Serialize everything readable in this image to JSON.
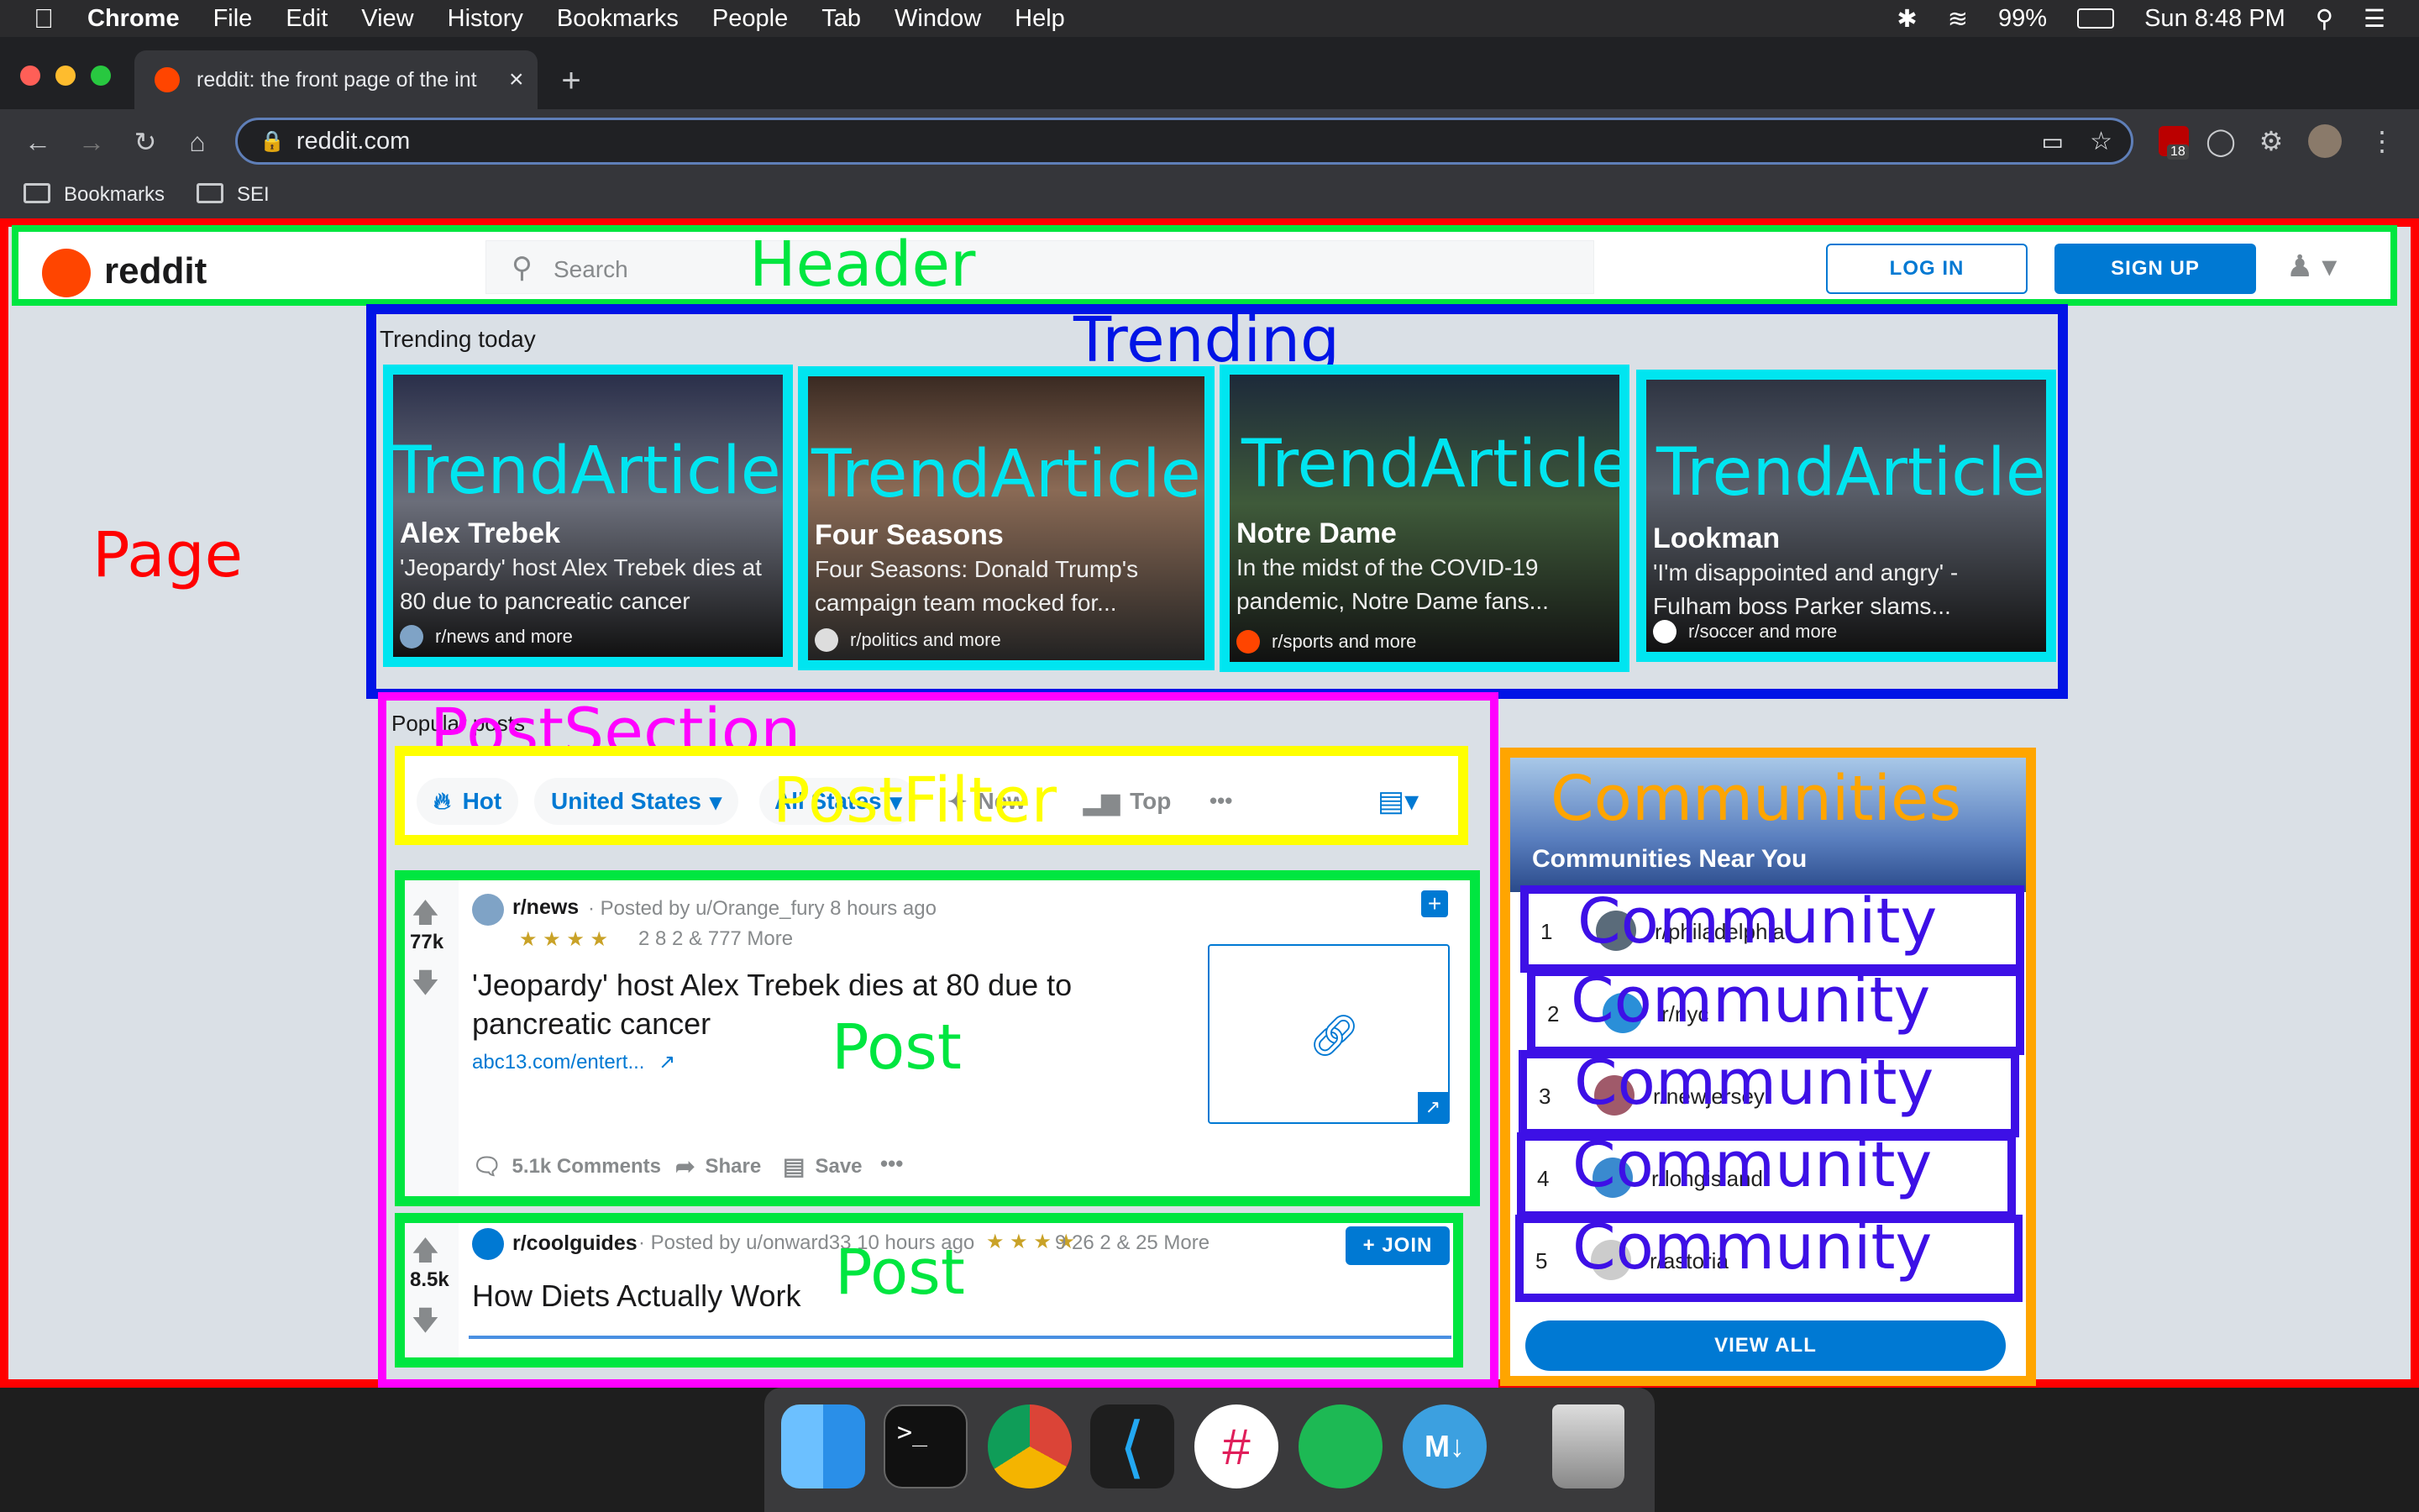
{
  "menubar": {
    "app": "Chrome",
    "items": [
      "File",
      "Edit",
      "View",
      "History",
      "Bookmarks",
      "People",
      "Tab",
      "Window",
      "Help"
    ],
    "battery": "99%",
    "clock": "Sun 8:48 PM"
  },
  "browser": {
    "tab_title": "reddit: the front page of the int",
    "url": "reddit.com",
    "bookmarks": [
      "Bookmarks",
      "SEI"
    ],
    "ext_badge": "18"
  },
  "header": {
    "logo": "reddit",
    "search_placeholder": "Search",
    "login": "LOG IN",
    "signup": "SIGN UP"
  },
  "trending": {
    "heading": "Trending today",
    "cards": [
      {
        "title": "Alex Trebek",
        "desc": "'Jeopardy' host Alex Trebek dies at 80 due to pancreatic cancer",
        "source": "r/news and more"
      },
      {
        "title": "Four Seasons",
        "desc": "Four Seasons: Donald Trump's campaign team mocked for...",
        "source": "r/politics and more"
      },
      {
        "title": "Notre Dame",
        "desc": "In the midst of the COVID-19 pandemic, Notre Dame fans...",
        "source": "r/sports and more"
      },
      {
        "title": "Lookman",
        "desc": "'I'm disappointed and angry' - Fulham boss Parker slams...",
        "source": "r/soccer and more"
      }
    ]
  },
  "popular": {
    "heading": "Popular posts",
    "filters": [
      "Hot",
      "United States",
      "All States",
      "New",
      "Top",
      "•••"
    ],
    "posts": [
      {
        "subreddit": "r/news",
        "meta": "· Posted by u/Orange_fury 8 hours ago",
        "awards": "2   8   2 & 777 More",
        "votes": "77k",
        "title": "'Jeopardy' host Alex Trebek dies at 80 due to pancreatic cancer",
        "link": "abc13.com/entert...",
        "comments": "5.1k Comments",
        "share": "Share",
        "save": "Save"
      },
      {
        "subreddit": "r/coolguides",
        "meta": "· Posted by u/onward33 10 hours ago",
        "awards": "9   26   2 & 25 More",
        "votes": "8.5k",
        "title": "How Diets Actually Work",
        "join": "+ JOIN"
      }
    ]
  },
  "communities": {
    "heading": "Communities Near You",
    "items": [
      {
        "rank": "1",
        "name": "r/philadelphia"
      },
      {
        "rank": "2",
        "name": "r/nyc"
      },
      {
        "rank": "3",
        "name": "r/newjersey"
      },
      {
        "rank": "4",
        "name": "r/longisland"
      },
      {
        "rank": "5",
        "name": "r/astoria"
      }
    ],
    "view_all": "VIEW ALL"
  },
  "annotations": {
    "page": "Page",
    "header": "Header",
    "trending": "Trending",
    "trend_article": "TrendArticle",
    "post_section": "PostSection",
    "post_filter": "PostFilter",
    "post": "Post",
    "communities": "Communities",
    "community": "Community"
  },
  "colors": {
    "page": "#ff0000",
    "header": "#00e640",
    "trending": "#0014e6",
    "trend_article": "#00e5f0",
    "post_section": "#ff00ff",
    "post_filter": "#ffff00",
    "post": "#00e640",
    "communities": "#ffa500",
    "community": "#3d10e6",
    "reddit_blue": "#0079d3",
    "reddit_orange": "#ff4500"
  }
}
